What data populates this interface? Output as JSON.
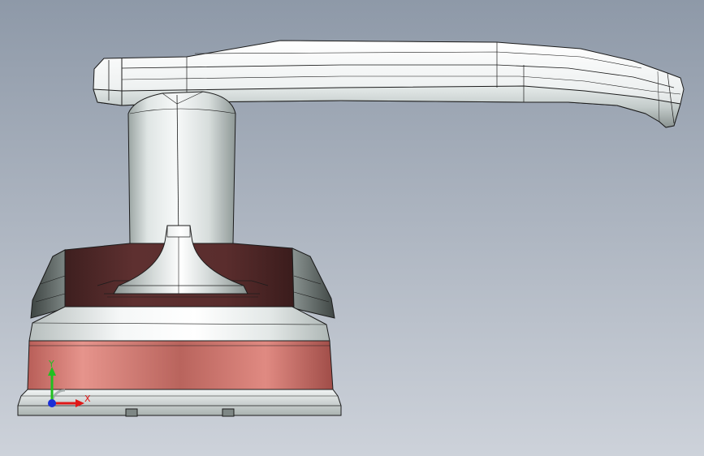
{
  "viewport": {
    "background_top": "#8e99a8",
    "background_bottom": "#cdd2da"
  },
  "model": {
    "edge_color": "#1c1c1c",
    "metal_light": "#f4f6f6",
    "metal_mid": "#c9d0cf",
    "metal_dark": "#6f7876",
    "dark_red": "#5a2d2d",
    "light_red": "#d47a72"
  },
  "triad": {
    "x_label": "X",
    "y_label": "Y",
    "x_color": "#e01818",
    "y_color": "#20c020",
    "origin_color": "#1a2fd8"
  }
}
